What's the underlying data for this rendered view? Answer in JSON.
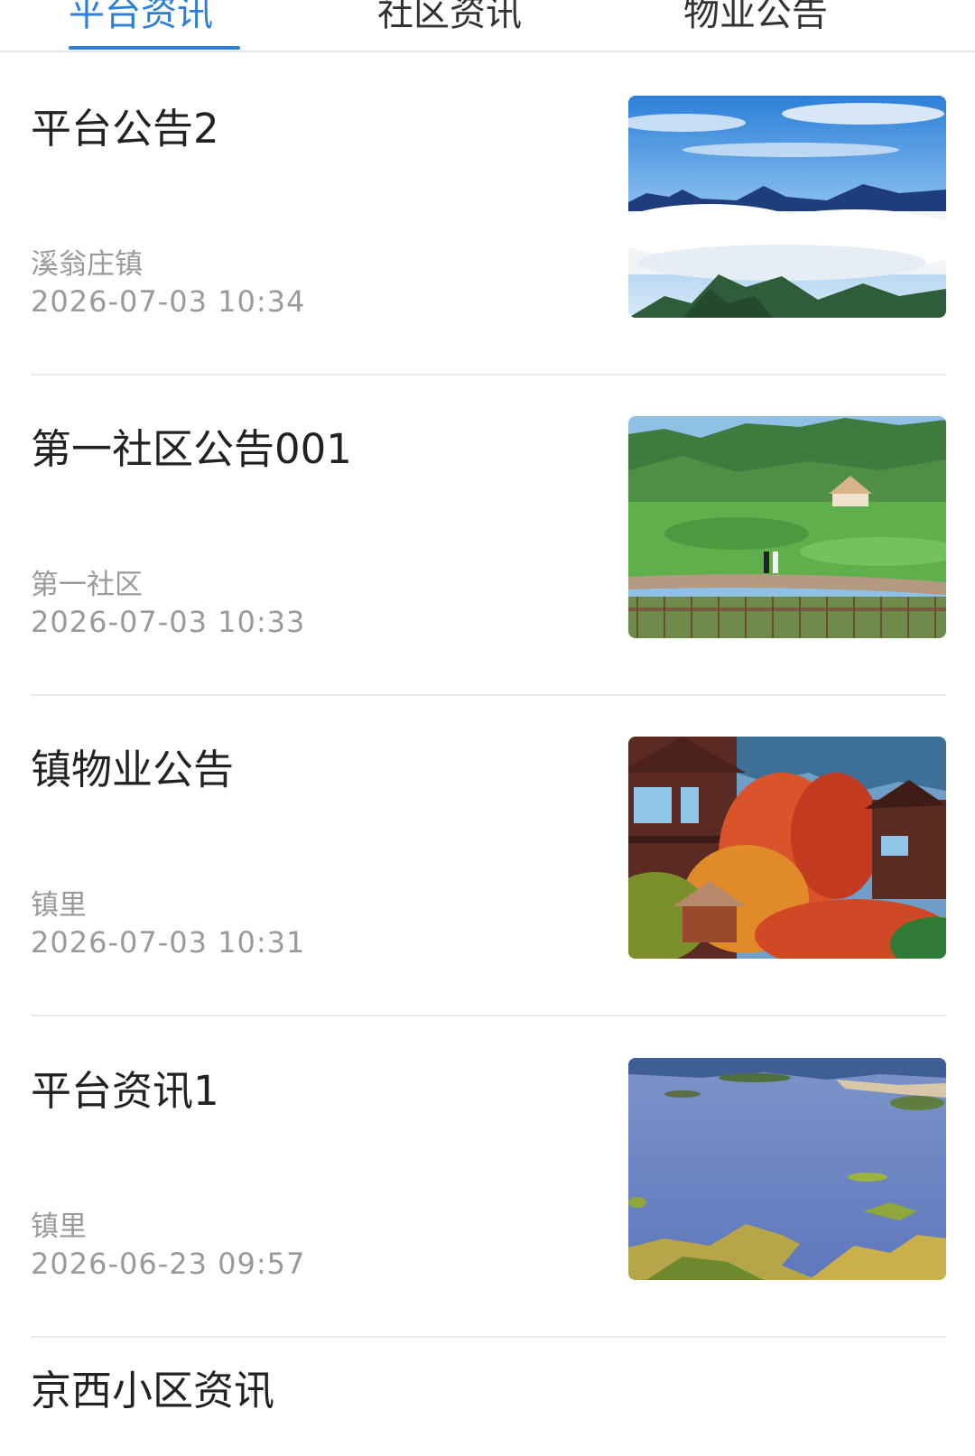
{
  "tabs": [
    {
      "label": "平台资讯",
      "active": true
    },
    {
      "label": "社区资讯",
      "active": false
    },
    {
      "label": "物业公告",
      "active": false
    }
  ],
  "colors": {
    "accent": "#2b7fd6",
    "title_text": "#222222",
    "meta_text": "#9a9a9a",
    "divider": "#e9e9e9"
  },
  "news": [
    {
      "title": "平台公告2",
      "source": "溪翁庄镇",
      "time": "2026-07-03 10:34",
      "image": "mountain-sea-of-clouds"
    },
    {
      "title": "第一社区公告001",
      "source": "第一社区",
      "time": "2026-07-03 10:33",
      "image": "green-hillside-cabin"
    },
    {
      "title": "镇物业公告",
      "source": "镇里",
      "time": "2026-07-03 10:31",
      "image": "autumn-wooden-lodges"
    },
    {
      "title": "平台资讯1",
      "source": "镇里",
      "time": "2026-06-23 09:57",
      "image": "lake-with-islands"
    },
    {
      "title": "京西小区资讯",
      "source": "",
      "time": "",
      "image": ""
    }
  ]
}
